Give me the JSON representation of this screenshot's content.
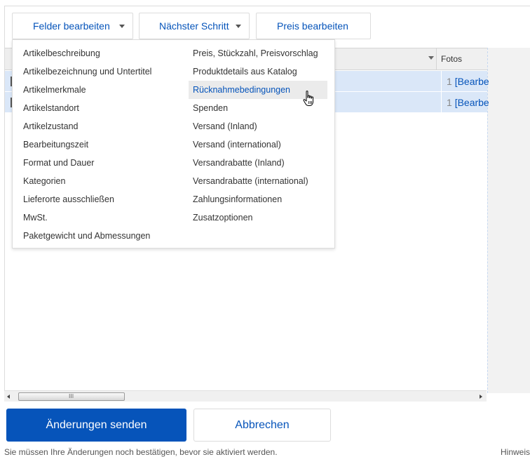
{
  "toolbar": {
    "edit_fields_label": "Felder bearbeiten",
    "next_step_label": "Nächster Schritt",
    "edit_price_label": "Preis bearbeiten"
  },
  "grid": {
    "fotos_header": "Fotos",
    "rows": [
      {
        "photo_count": "1",
        "photo_link": "[Bearbe"
      },
      {
        "photo_count": "1",
        "photo_link": "[Bearbe"
      }
    ]
  },
  "menu": {
    "left_items": [
      "Artikelbeschreibung",
      "Artikelbezeichnung und Untertitel",
      "Artikelmerkmale",
      "Artikelstandort",
      "Artikelzustand",
      "Bearbeitungszeit",
      "Format und Dauer",
      "Kategorien",
      "Lieferorte ausschließen",
      "MwSt.",
      "Paketgewicht und Abmessungen"
    ],
    "right_items": [
      "Preis, Stückzahl, Preisvorschlag",
      "Produktdetails aus Katalog",
      "Rücknahmebedingungen",
      "Spenden",
      "Versand (Inland)",
      "Versand (international)",
      "Versandrabatte (Inland)",
      "Versandrabatte (international)",
      "Zahlungsinformationen",
      "Zusatzoptionen"
    ],
    "highlighted": "Rücknahmebedingungen"
  },
  "scrollbar": {
    "grip": "III"
  },
  "actions": {
    "submit_label": "Änderungen senden",
    "cancel_label": "Abbrechen"
  },
  "footer": {
    "note": "Sie müssen Ihre Änderungen noch bestätigen, bevor sie aktiviert werden.",
    "hint": "Hinweis"
  },
  "colors": {
    "accent": "#0654ba",
    "row_selected": "#dae7f8",
    "menu_hover": "#ebebeb"
  },
  "icons": {
    "dropdown": "chevron-down-icon",
    "sort": "sort-down-icon",
    "cursor": "hand-pointer-icon"
  }
}
